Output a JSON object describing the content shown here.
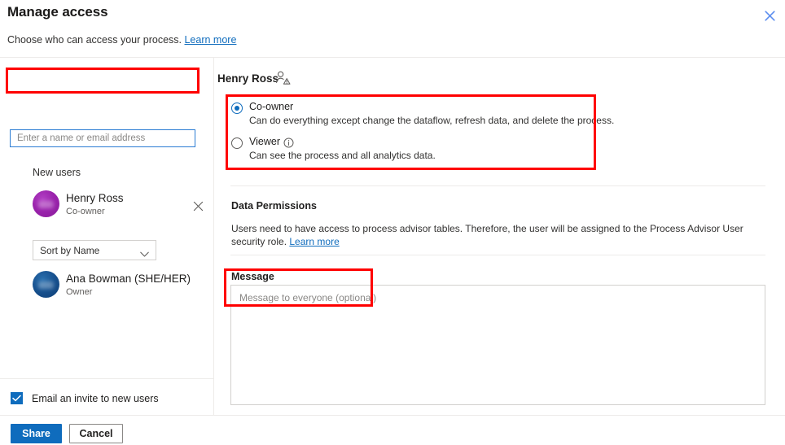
{
  "header": {
    "title": "Manage access",
    "subtitle_text": "Choose who can access your process.",
    "subtitle_link": "Learn more",
    "close_icon": "close-icon"
  },
  "search": {
    "placeholder": "Enter a name or email address",
    "value": ""
  },
  "left_pane": {
    "new_users_label": "New users",
    "new_users": [
      {
        "name": "Henry Ross",
        "role": "Co-owner",
        "avatar_color": "#9b23ad",
        "remove_icon": "close-icon"
      }
    ],
    "sort": {
      "selected": "Sort by Name",
      "chevron_icon": "chevron-down-icon",
      "options": [
        "Sort by Name"
      ]
    },
    "existing_users": [
      {
        "name": "Ana Bowman (SHE/HER)",
        "role": "Owner",
        "avatar_color": "#17518f"
      }
    ],
    "email_invite": {
      "label": "Email an invite to new users",
      "checked": true,
      "check_icon": "check-icon"
    }
  },
  "footer": {
    "share_label": "Share",
    "cancel_label": "Cancel"
  },
  "right_pane": {
    "selected_user": "Henry Ross",
    "selected_user_icon": "person-badge-icon",
    "roles": [
      {
        "label": "Co-owner",
        "description": "Can do everything except change the dataflow, refresh data, and delete the process.",
        "selected": true
      },
      {
        "label": "Viewer",
        "description": "Can see the process and all analytics data.",
        "selected": false,
        "info_icon": "info-icon"
      }
    ],
    "data_permissions": {
      "title": "Data Permissions",
      "body": "Users need to have access to process advisor tables. Therefore, the user will be assigned to the Process Advisor User security role.",
      "link": "Learn more"
    },
    "message": {
      "label": "Message",
      "placeholder": "Message to everyone (optional)",
      "value": ""
    }
  },
  "colors": {
    "accent": "#0f6cbd",
    "annotation": "#ff0000",
    "link": "#0f6cbd",
    "divider": "#edebe9"
  }
}
